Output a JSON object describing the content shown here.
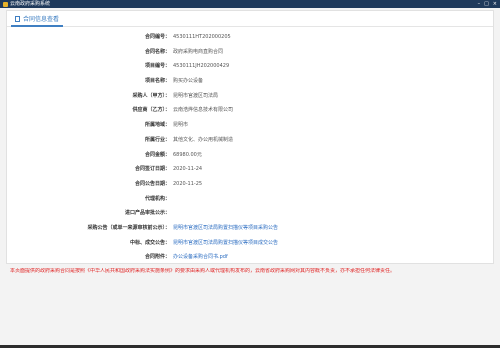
{
  "window": {
    "title": "云南政府采购系统"
  },
  "tab": {
    "label": "合同信息查看"
  },
  "fields": [
    {
      "label": "合同编号：",
      "value": "4530111HT202000205",
      "link": false
    },
    {
      "label": "合同名称：",
      "value": "政府采购电商直购合同",
      "link": false
    },
    {
      "label": "项目编号：",
      "value": "4530111JH202000429",
      "link": false
    },
    {
      "label": "项目名称：",
      "value": "购买办公设备",
      "link": false
    },
    {
      "label": "采购人（甲方）：",
      "value": "昆明市官渡区司法局",
      "link": false
    },
    {
      "label": "供应商（乙方）：",
      "value": "云南浩烨信息技术有限公司",
      "link": false
    },
    {
      "label": "所属地域：",
      "value": "昆明市",
      "link": false
    },
    {
      "label": "所属行业：",
      "value": "其他文化、办公用机械制造",
      "link": false
    },
    {
      "label": "合同金额：",
      "value": "68980.00元",
      "link": false
    },
    {
      "label": "合同签订日期：",
      "value": "2020-11-24",
      "link": false
    },
    {
      "label": "合同公告日期：",
      "value": "2020-11-25",
      "link": false
    },
    {
      "label": "代理机构：",
      "value": "",
      "link": false
    },
    {
      "label": "进口产品审批公示：",
      "value": "",
      "link": false
    },
    {
      "label": "采购公告（或单一来源审核前公示）：",
      "value": "昆明市官渡区司法局购置扫描仪等项目采购公告",
      "link": true
    },
    {
      "label": "中标、成交公告：",
      "value": "昆明市官渡区司法局购置扫描仪等项目成交公告",
      "link": true
    },
    {
      "label": "合同附件：",
      "value": "办公设备采购合同书.pdf",
      "link": true
    }
  ],
  "notice": "本页面提供的政府采购合同是按照《中华人民共和国政府采购法实施条例》的要求由采购人或代理机构发布的，云南省政府采购网对其内容概不负责，亦不承担任何法律责任。",
  "colors": {
    "title_bar": "#1f3a5c",
    "accent": "#3f7fc2",
    "link": "#2a6cc1",
    "notice": "#e02020"
  }
}
